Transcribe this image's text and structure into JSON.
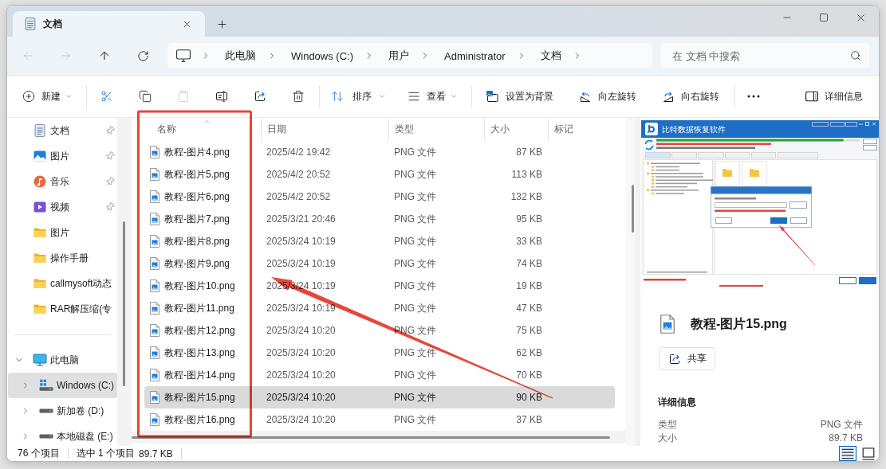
{
  "window": {
    "tabs": [
      {
        "label": "文档",
        "selected": true
      }
    ]
  },
  "navigation": [
    {
      "kind": "back",
      "disabled": true
    },
    {
      "kind": "forward",
      "disabled": true
    },
    {
      "kind": "up",
      "disabled": false
    },
    {
      "kind": "refresh",
      "disabled": false
    }
  ],
  "address_bar": {
    "crumbs": [
      "此电脑",
      "Windows (C:)",
      "用户",
      "Administrator",
      "文档"
    ]
  },
  "search": {
    "placeholder": "在 文档 中搜索"
  },
  "toolbar": {
    "new": {
      "label": "新建"
    },
    "actions": [
      {
        "kind": "cut",
        "disabled": false
      },
      {
        "kind": "copy",
        "disabled": false
      },
      {
        "kind": "paste",
        "disabled": true
      },
      {
        "kind": "rename",
        "disabled": false
      },
      {
        "kind": "share",
        "disabled": false
      },
      {
        "kind": "delete",
        "disabled": false
      }
    ],
    "sort": {
      "label": "排序"
    },
    "view": {
      "label": "查看"
    },
    "image_actions": [
      {
        "kind": "set_background",
        "label": "设置为背景"
      },
      {
        "kind": "rotate_left",
        "label": "向左旋转"
      },
      {
        "kind": "rotate_right",
        "label": "向右旋转"
      }
    ],
    "details": {
      "label": "详细信息"
    }
  },
  "sidebar": {
    "quick_access": [
      {
        "kind": "documents",
        "label": "文档",
        "pinned": true,
        "selected": false
      },
      {
        "kind": "pictures",
        "label": "图片",
        "pinned": true,
        "selected": false
      },
      {
        "kind": "music",
        "label": "音乐",
        "pinned": true,
        "selected": false
      },
      {
        "kind": "videos",
        "label": "视频",
        "pinned": true,
        "selected": false
      },
      {
        "kind": "folder",
        "label": "图片",
        "pinned": false,
        "selected": false
      },
      {
        "kind": "folder",
        "label": "操作手册",
        "pinned": false,
        "selected": false
      },
      {
        "kind": "folder",
        "label": "callmysoft动态",
        "pinned": false,
        "selected": false
      },
      {
        "kind": "folder",
        "label": "RAR解压缩(专",
        "pinned": false,
        "selected": false
      }
    ],
    "this_pc": {
      "label": "此电脑",
      "expanded": true,
      "selected": false,
      "children": [
        {
          "kind": "system_drive",
          "label": "Windows (C:)",
          "expanded": false,
          "selected": true
        },
        {
          "kind": "drive",
          "label": "新加卷 (D:)",
          "expanded": false,
          "selected": false
        },
        {
          "kind": "drive",
          "label": "本地磁盘 (E:)",
          "expanded": false,
          "selected": false
        }
      ]
    }
  },
  "file_list": {
    "columns": [
      {
        "label": "名称",
        "sorted": true
      },
      {
        "label": "日期",
        "sorted": false
      },
      {
        "label": "类型",
        "sorted": false
      },
      {
        "label": "大小",
        "sorted": false
      },
      {
        "label": "标记",
        "sorted": false
      }
    ],
    "rows": [
      {
        "name": "教程-图片4.png",
        "date": "2025/4/2 19:42",
        "type": "PNG 文件",
        "size": "87 KB",
        "selected": false
      },
      {
        "name": "教程-图片5.png",
        "date": "2025/4/2 20:52",
        "type": "PNG 文件",
        "size": "113 KB",
        "selected": false
      },
      {
        "name": "教程-图片6.png",
        "date": "2025/4/2 20:52",
        "type": "PNG 文件",
        "size": "132 KB",
        "selected": false
      },
      {
        "name": "教程-图片7.png",
        "date": "2025/3/21 20:46",
        "type": "PNG 文件",
        "size": "95 KB",
        "selected": false
      },
      {
        "name": "教程-图片8.png",
        "date": "2025/3/24 10:19",
        "type": "PNG 文件",
        "size": "33 KB",
        "selected": false
      },
      {
        "name": "教程-图片9.png",
        "date": "2025/3/24 10:19",
        "type": "PNG 文件",
        "size": "74 KB",
        "selected": false
      },
      {
        "name": "教程-图片10.png",
        "date": "2025/3/24 10:19",
        "type": "PNG 文件",
        "size": "19 KB",
        "selected": false
      },
      {
        "name": "教程-图片11.png",
        "date": "2025/3/24 10:19",
        "type": "PNG 文件",
        "size": "47 KB",
        "selected": false
      },
      {
        "name": "教程-图片12.png",
        "date": "2025/3/24 10:20",
        "type": "PNG 文件",
        "size": "75 KB",
        "selected": false
      },
      {
        "name": "教程-图片13.png",
        "date": "2025/3/24 10:20",
        "type": "PNG 文件",
        "size": "62 KB",
        "selected": false
      },
      {
        "name": "教程-图片14.png",
        "date": "2025/3/24 10:20",
        "type": "PNG 文件",
        "size": "70 KB",
        "selected": false
      },
      {
        "name": "教程-图片15.png",
        "date": "2025/3/24 10:20",
        "type": "PNG 文件",
        "size": "90 KB",
        "selected": true
      },
      {
        "name": "教程-图片16.png",
        "date": "2025/3/24 10:20",
        "type": "PNG 文件",
        "size": "37 KB",
        "selected": false
      }
    ]
  },
  "preview": {
    "screenshot": {
      "title": "比特数据恢复软件",
      "progress": {
        "level": 0.92
      }
    },
    "file_name": "教程-图片15.png",
    "share": {
      "label": "共享"
    },
    "details": {
      "heading": "详细信息",
      "fields": [
        {
          "label": "类型",
          "value": "PNG 文件"
        },
        {
          "label": "大小",
          "value": "89.7 KB"
        }
      ]
    }
  },
  "status_bar": {
    "item_count": "76 个项目",
    "selection": "选中 1 个项目",
    "selection_size": "89.7 KB",
    "views": [
      {
        "kind": "details",
        "selected": true
      },
      {
        "kind": "tiles",
        "selected": false
      }
    ]
  }
}
